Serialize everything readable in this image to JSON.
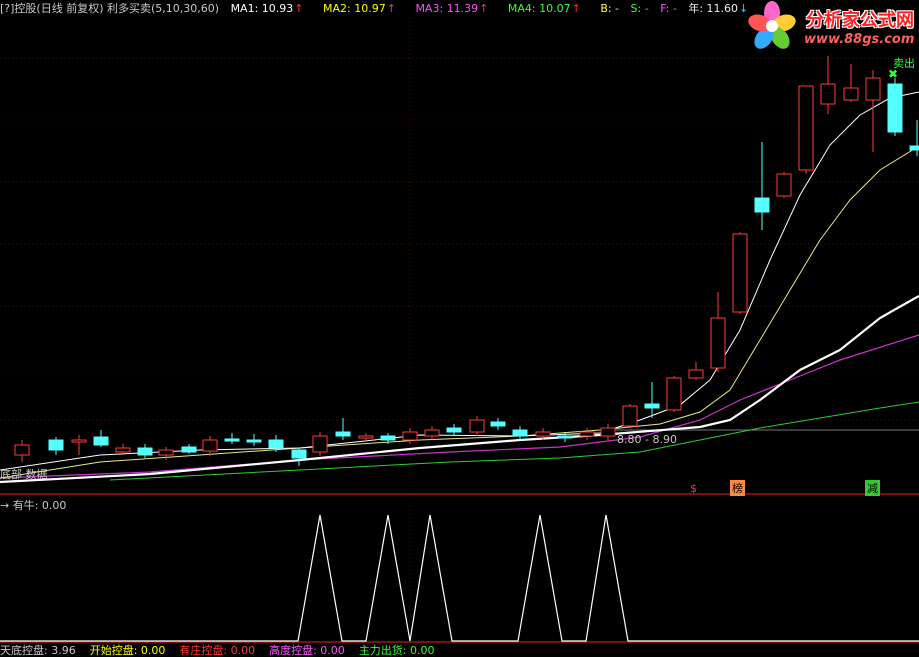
{
  "header": {
    "title": "[?]控股(日线 前复权) 利多买卖(5,10,30,60)",
    "ma1_label": "MA1: 10.93",
    "ma2_label": "MA2: 10.97",
    "ma3_label": "MA3: 11.39",
    "ma4_label": "MA4: 10.07",
    "b_label": "B: -",
    "s_label": "S: -",
    "f_label": "F: -",
    "year_label": "年: 11.60",
    "up_arrow": "↑",
    "down_arrow": "↓"
  },
  "logo": {
    "title": "分析家公式网",
    "url": "www.88gs.com"
  },
  "signals": {
    "sell_label": "卖出",
    "sell_mark": "✖",
    "range_label": "8.80 - 8.90",
    "dollar_mark": "$",
    "bang_label": "榜",
    "jian_label": "减",
    "bottom_left_label": "底部 数据"
  },
  "indicator": {
    "label": "有牛: 0.00"
  },
  "footer": {
    "items": [
      {
        "text": "天底控盘: 3.96",
        "color": "#c8c8c8"
      },
      {
        "text": "开始控盘: 0.00",
        "color": "#ffff00"
      },
      {
        "text": "有庄控盘: 0.00",
        "color": "#ff3333"
      },
      {
        "text": "高度控盘: 0.00",
        "color": "#ff55ff"
      },
      {
        "text": "主力出货: 0.00",
        "color": "#33ff33"
      }
    ]
  },
  "colors": {
    "up": "#ff3c3c",
    "down": "#54ffff",
    "ma_white": "#ffffff",
    "ma_yellow": "#e8e88a",
    "ma_magenta": "#cc33cc",
    "ma_green": "#33cc33",
    "divider": "#a01414"
  }
}
